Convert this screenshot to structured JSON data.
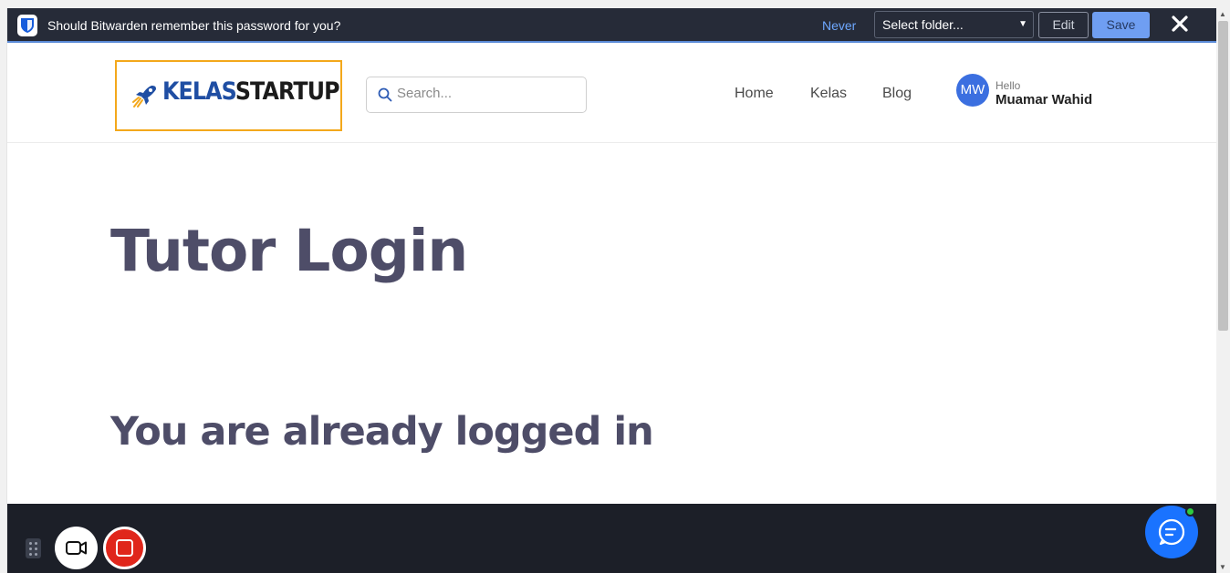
{
  "bitwarden": {
    "question": "Should Bitwarden remember this password for you?",
    "never_label": "Never",
    "folder_select": "Select folder...",
    "edit_label": "Edit",
    "save_label": "Save",
    "close_icon": "close-icon"
  },
  "header": {
    "logo_kelas": "KELAS",
    "logo_startup": "STARTUP",
    "search_placeholder": "Search...",
    "nav": [
      "Home",
      "Kelas",
      "Blog"
    ],
    "user": {
      "initials": "MW",
      "greeting": "Hello",
      "name": "Muamar Wahid"
    }
  },
  "main": {
    "title": "Tutor Login",
    "message": "You are already logged in"
  },
  "toolbar": {
    "camera_icon": "video-camera-icon",
    "stop_icon": "stop-recording-icon",
    "chat_icon": "chat-icon"
  },
  "colors": {
    "bitwarden_bar": "#262b38",
    "save_button": "#6f9ef2",
    "logo_border": "#f3a81b",
    "logo_kelas": "#1f4ea3",
    "heading": "#4e4d68",
    "avatar": "#3b6fe0",
    "bottom_bar": "#1c1f28",
    "chat_button": "#1a73ff",
    "stop_button": "#e0261b"
  }
}
